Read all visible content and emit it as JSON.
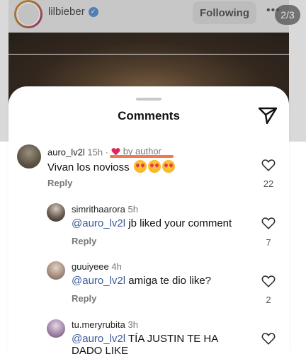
{
  "post_header": {
    "username": "lilbieber",
    "follow_label": "Following",
    "more_label": "•••",
    "counter": "2/3"
  },
  "sheet": {
    "title": "Comments"
  },
  "comments": [
    {
      "username": "auro_lv2l",
      "time": "15h",
      "tag": "by author",
      "text": "Vivan los novioss",
      "reply_label": "Reply",
      "likes": "22"
    },
    {
      "username": "simrithaarora",
      "time": "5h",
      "mention": "@auro_lv2l",
      "text": " jb liked your comment",
      "reply_label": "Reply",
      "likes": "7"
    },
    {
      "username": "guuiyeee",
      "time": "4h",
      "mention": "@auro_lv2l",
      "text": " amiga te dio like?",
      "reply_label": "Reply",
      "likes": "2"
    },
    {
      "username": "tu.meryrubita",
      "time": "3h",
      "mention": "@auro_lv2l",
      "text": " TÍA JUSTIN TE HA",
      "text_line2": "DADO LIKE"
    }
  ],
  "colors": {
    "accent_link": "#3b5998",
    "heart_red": "#e0245e",
    "highlight": "#ef7a52",
    "verified_blue": "#5b8ec9"
  },
  "icons": [
    "verified-icon",
    "share-icon",
    "heart-icon",
    "like-heart-icon",
    "heart-eyes-emoji"
  ]
}
